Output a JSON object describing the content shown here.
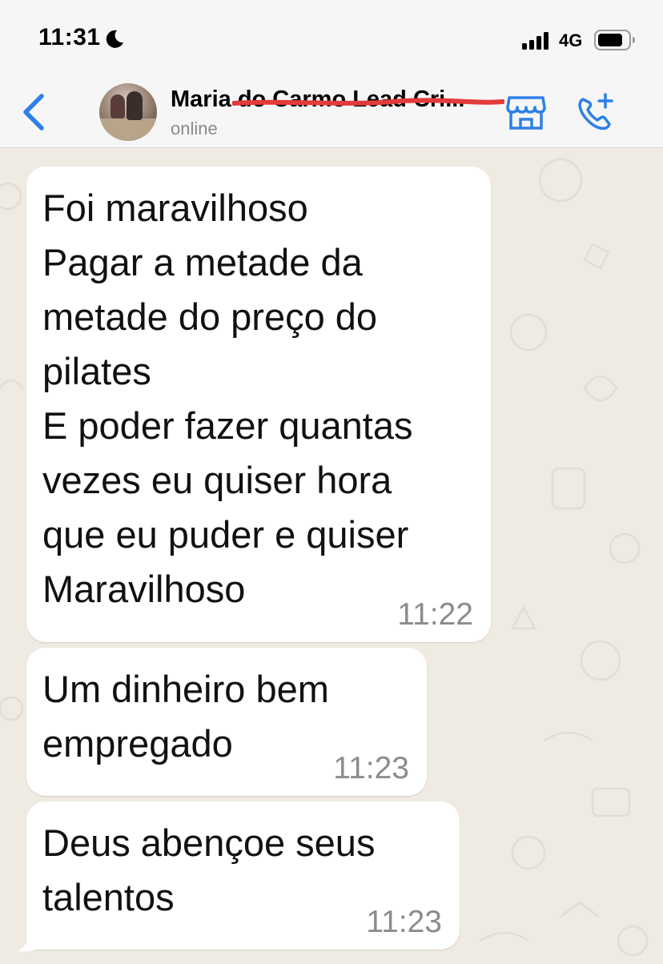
{
  "status_bar": {
    "time": "11:31",
    "network": "4G",
    "icons": [
      "moon-icon",
      "signal-icon",
      "battery-icon"
    ]
  },
  "header": {
    "contact_name": "Maria do Carmo Lead Cri...",
    "status": "online",
    "icons": [
      "back-chevron-icon",
      "avatar",
      "shop-icon",
      "add-call-icon"
    ],
    "accent_color": "#2f7fe6",
    "redaction_color": "#e23b3b"
  },
  "messages": [
    {
      "text": "Foi maravilhoso\nPagar a metade da\nmetade do preço do\npilates\nE poder fazer quantas\nvezes eu quiser hora\nque eu puder e quiser\nMaravilhoso",
      "time": "11:22"
    },
    {
      "text": "Um dinheiro bem\nempregado",
      "time": "11:23"
    },
    {
      "text": "Deus abençoe seus\ntalentos",
      "time": "11:23"
    }
  ],
  "colors": {
    "chat_background": "#efeae2",
    "bubble": "#ffffff",
    "timestamp": "#8c8c8c"
  }
}
